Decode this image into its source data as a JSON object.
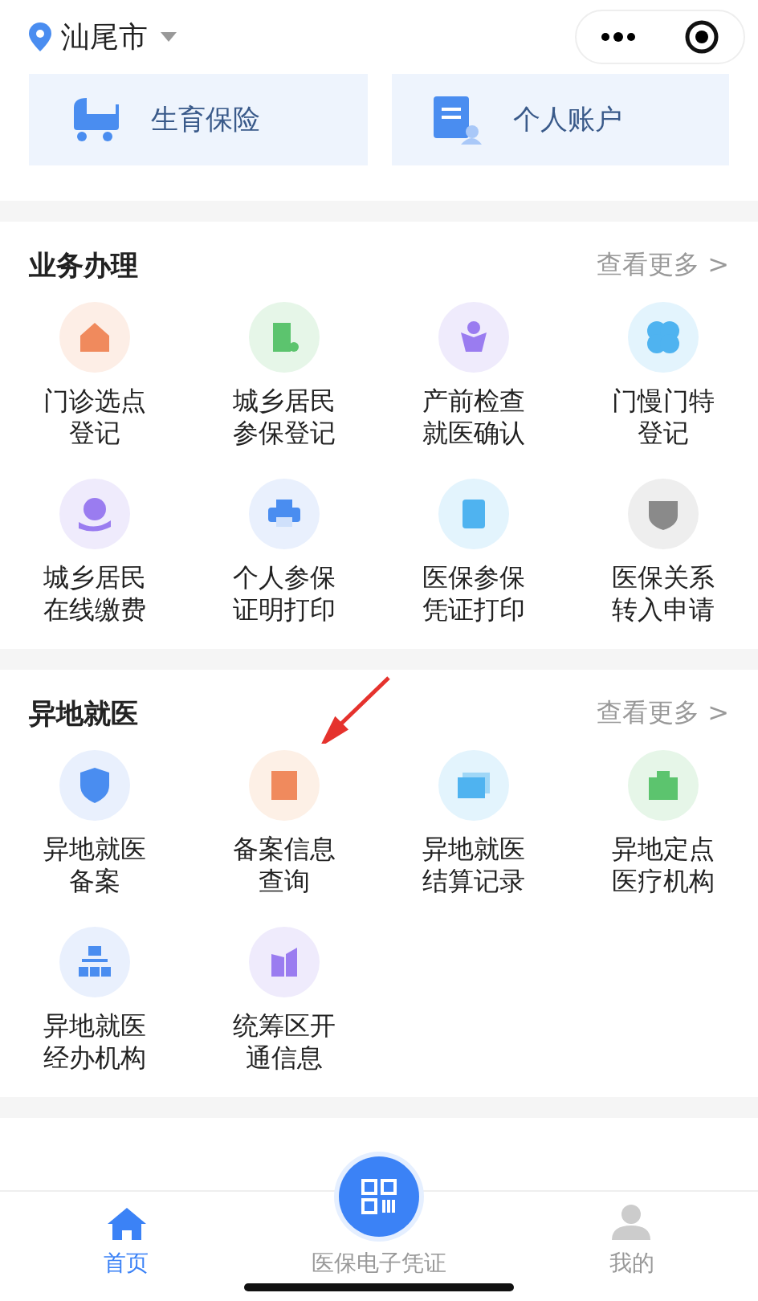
{
  "header": {
    "city": "汕尾市"
  },
  "banners": [
    {
      "label": "生育保险"
    },
    {
      "label": "个人账户"
    }
  ],
  "sections": [
    {
      "title": "业务办理",
      "more": "查看更多 >",
      "items": [
        {
          "label": "门诊选点登记"
        },
        {
          "label": "城乡居民参保登记"
        },
        {
          "label": "产前检查就医确认"
        },
        {
          "label": "门慢门特登记"
        },
        {
          "label": "城乡居民在线缴费"
        },
        {
          "label": "个人参保证明打印"
        },
        {
          "label": "医保参保凭证打印"
        },
        {
          "label": "医保关系转入申请"
        }
      ]
    },
    {
      "title": "异地就医",
      "more": "查看更多 >",
      "items": [
        {
          "label": "异地就医备案"
        },
        {
          "label": "备案信息查询"
        },
        {
          "label": "异地就医结算记录"
        },
        {
          "label": "异地定点医疗机构"
        },
        {
          "label": "异地就医经办机构"
        },
        {
          "label": "统筹区开通信息"
        }
      ]
    }
  ],
  "tabbar": [
    {
      "label": "首页",
      "selected": true
    },
    {
      "label": "医保电子凭证",
      "selected": false
    },
    {
      "label": "我的",
      "selected": false
    }
  ]
}
